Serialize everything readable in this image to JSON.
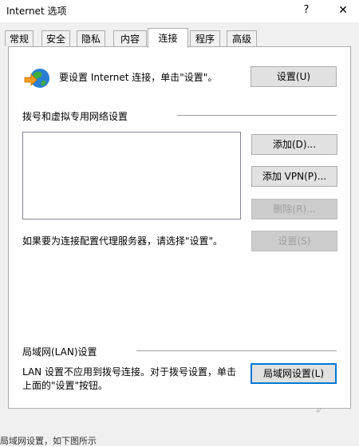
{
  "window": {
    "title": "Internet 选项",
    "help": "?",
    "close": "✕"
  },
  "tabs": [
    "常规",
    "安全",
    "隐私",
    "内容",
    "连接",
    "程序",
    "高级"
  ],
  "active_tab": "连接",
  "setup": {
    "text": "要设置 Internet 连接，单击\"设置\"。",
    "button": "设置(U)"
  },
  "dialup": {
    "heading": "拨号和虚拟专用网络设置",
    "add": "添加(D)...",
    "add_vpn": "添加 VPN(P)...",
    "remove": "删除(R)...",
    "proxy_text": "如果要为连接配置代理服务器，请选择\"设置\"。",
    "settings": "设置(S)"
  },
  "lan": {
    "heading": "局域网(LAN)设置",
    "text": "LAN 设置不应用到拨号连接。对于拨号设置，单击上面的\"设置\"按钮。",
    "button": "局域网设置(L)"
  },
  "caption": "局域网设置，如下图所示"
}
